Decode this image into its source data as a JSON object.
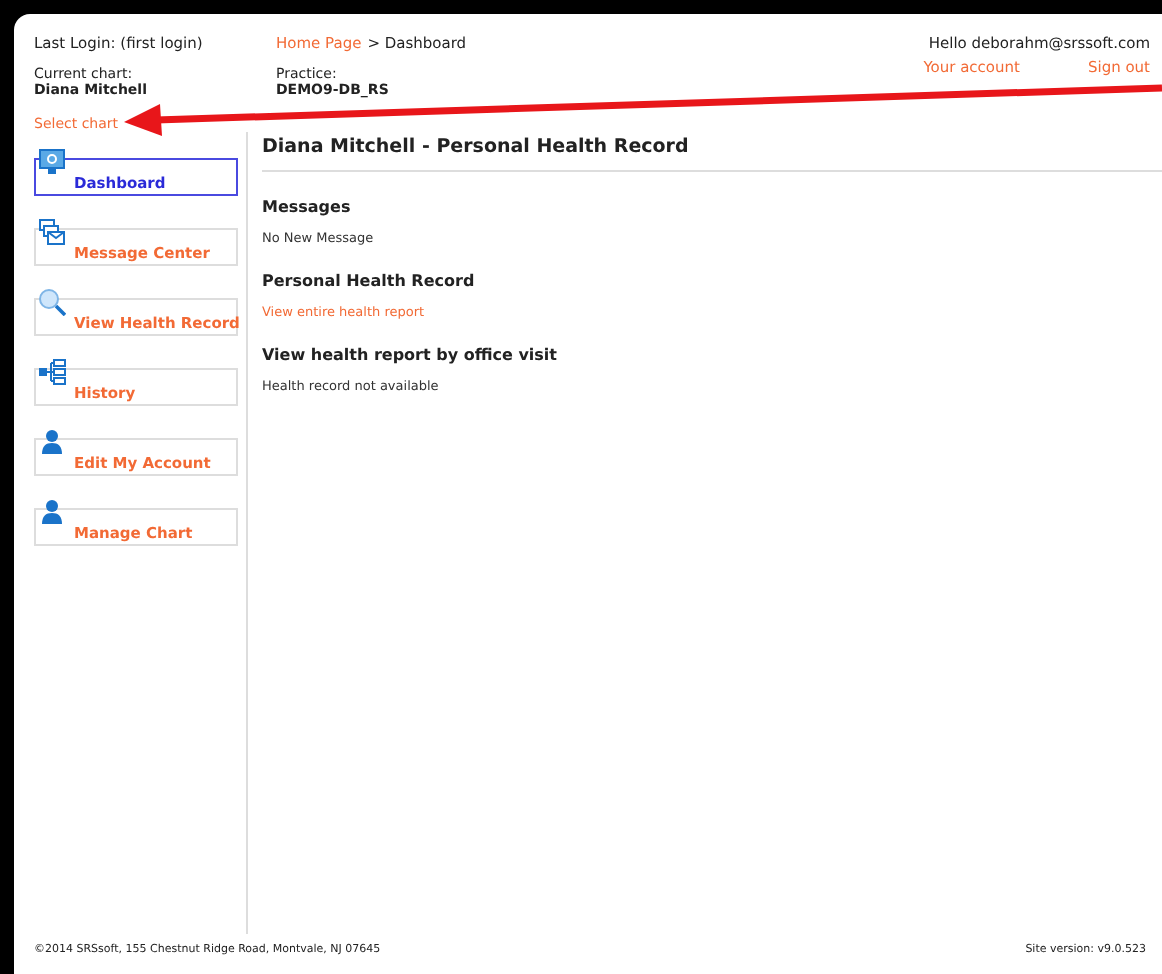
{
  "header": {
    "last_login": "Last Login: (first login)",
    "breadcrumb": [
      {
        "label": "Home Page",
        "link": true
      },
      {
        "label": "> Dashboard",
        "link": false
      }
    ],
    "current_chart_label": "Current chart:",
    "current_chart": "Diana Mitchell",
    "practice_label": "Practice:",
    "practice": "DEMO9-DB_RS",
    "select_chart": "Select chart",
    "greeting": "Hello deborahm@srssoft.com",
    "links": [
      "Your account",
      "Sign out"
    ]
  },
  "sidebar": {
    "items": [
      {
        "label": "Dashboard",
        "kind": "monitor",
        "selected": true
      },
      {
        "label": "Message Center",
        "kind": "envelopes",
        "selected": false
      },
      {
        "label": "View Health Record",
        "kind": "magnifier",
        "selected": false
      },
      {
        "label": "History",
        "kind": "tree",
        "selected": false
      },
      {
        "label": "Edit My Account",
        "kind": "person",
        "selected": false
      },
      {
        "label": "Manage Chart",
        "kind": "person",
        "selected": false
      }
    ]
  },
  "main": {
    "title": "Diana Mitchell - Personal Health Record",
    "sections": [
      {
        "heading": "Messages",
        "text": "No New Message",
        "link": false
      },
      {
        "heading": "Personal Health Record",
        "text": "View entire health report",
        "link": true
      },
      {
        "heading": "View health report by office visit",
        "text": "Health record not available",
        "link": false
      }
    ]
  },
  "footer": {
    "copyright": "©2014 SRSsoft, 155 Chestnut Ridge Road, Montvale, NJ 07645",
    "version": "Site version: v9.0.523"
  }
}
